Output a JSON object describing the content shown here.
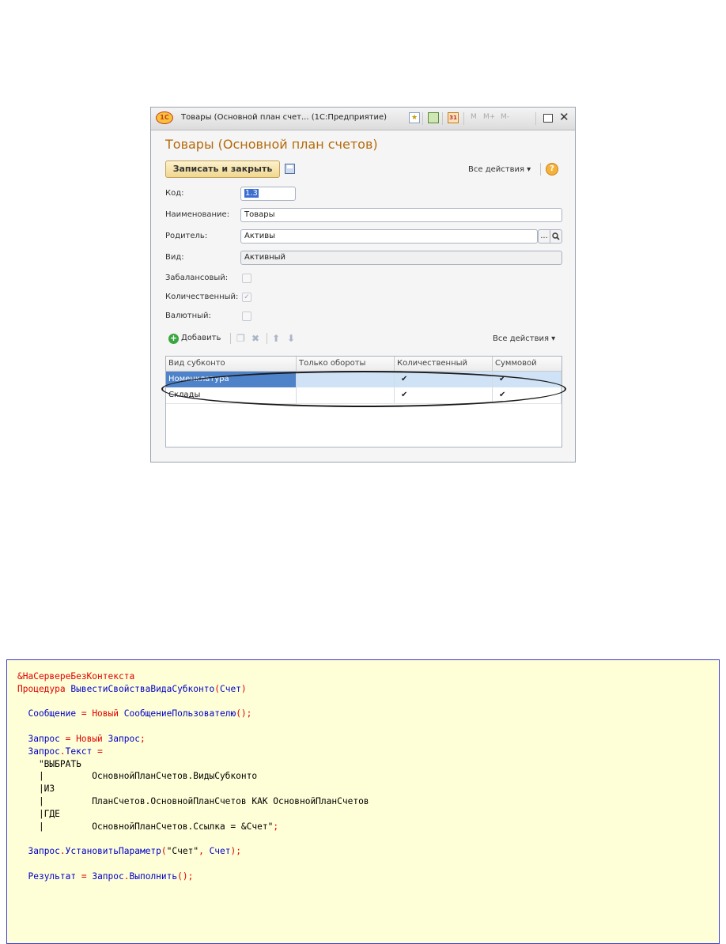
{
  "window": {
    "title": "Товары (Основной план счет... (1С:Предприятие)",
    "logo": "1С",
    "toolbar": {
      "m_label": "M",
      "mplus_label": "M+",
      "mminus_label": "M-",
      "calendar_label": "31"
    },
    "icons": [
      "favorite-icon",
      "calculator-icon",
      "calendar-icon",
      "restore-window-icon",
      "close-icon"
    ]
  },
  "form": {
    "title": "Товары (Основной план счетов)",
    "save_close_label": "Записать и закрыть",
    "all_actions_label": "Все действия ▾",
    "help_label": "?",
    "fields": {
      "code_label": "Код:",
      "code_value": "1.3",
      "name_label": "Наименование:",
      "name_value": "Товары",
      "parent_label": "Родитель:",
      "parent_value": "Активы",
      "parent_select_label": "...",
      "kind_label": "Вид:",
      "kind_value": "Активный",
      "offbalance_label": "Забалансовый:",
      "quantitative_label": "Количественный:",
      "currency_label": "Валютный:"
    },
    "checkboxes": {
      "offbalance": false,
      "quantitative": true,
      "currency": false
    },
    "table_toolbar": {
      "add_label": "Добавить",
      "all_actions_label": "Все действия ▾"
    },
    "table": {
      "columns": [
        "Вид субконто",
        "Только обороты",
        "Количественный",
        "Суммовой"
      ],
      "rows": [
        {
          "vid": "Номенклатура",
          "only_turnover": "",
          "quantitative": "✔",
          "sum": "✔"
        },
        {
          "vid": "Склады",
          "only_turnover": "",
          "quantitative": "✔",
          "sum": "✔"
        }
      ]
    }
  },
  "code": {
    "lines": [
      "&НаСервереБезКонтекста",
      "Процедура ВывестиСвойстваВидаСубконто(Счет)",
      "",
      "  Сообщение = Новый СообщениеПользователю();",
      "",
      "  Запрос = Новый Запрос;",
      "  Запрос.Текст =",
      "    \"ВЫБРАТЬ",
      "    |         ОсновнойПланСчетов.ВидыСубконто",
      "    |ИЗ",
      "    |         ПланСчетов.ОсновнойПланСчетов КАК ОсновнойПланСчетов",
      "    |ГДЕ",
      "    |         ОсновнойПланСчетов.Ссылка = &Счет\";",
      "",
      "  Запрос.УстановитьПараметр(\"Счет\", Счет);",
      "",
      "  Результат = Запрос.Выполнить();"
    ]
  }
}
